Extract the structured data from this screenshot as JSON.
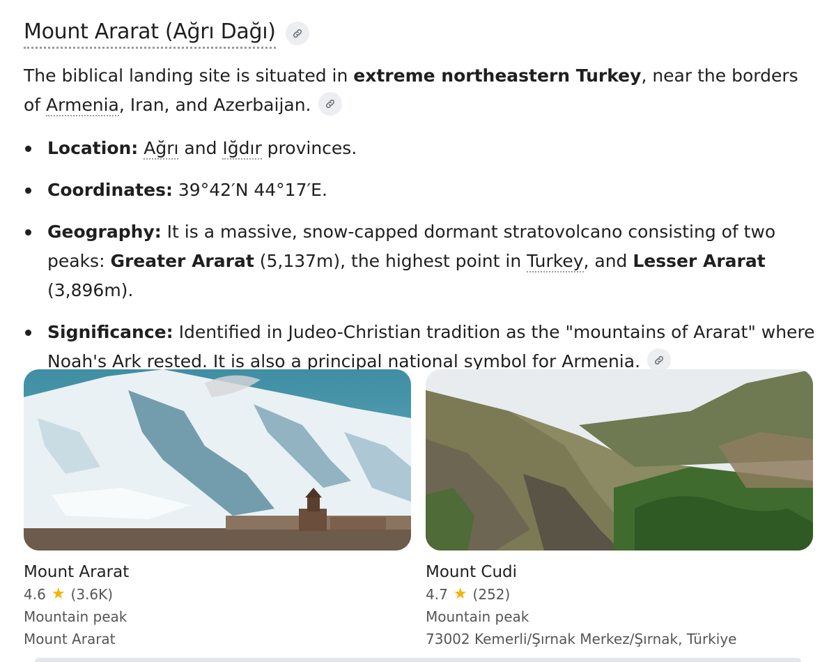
{
  "heading": {
    "title": "Mount Ararat (Ağrı Dağı)",
    "link_icon": "link-icon"
  },
  "intro": {
    "part1": "The biblical landing site is situated in ",
    "bold": "extreme northeastern Turkey",
    "part2": ", near the borders of ",
    "armenia": "Armenia",
    "part3": ", Iran, and Azerbaijan."
  },
  "bullets": {
    "location": {
      "label": "Location:",
      "t1": " ",
      "agri": "Ağrı",
      "t2": " and ",
      "igdir": "Iğdır",
      "t3": " provinces."
    },
    "coordinates": {
      "label": "Coordinates:",
      "text": " 39°42′N 44°17′E."
    },
    "geography": {
      "label": "Geography:",
      "t1": " It is a massive, snow-capped dormant stratovolcano consisting of two peaks: ",
      "b1": "Greater Ararat",
      "t2": " (5,137m), the highest point in ",
      "turkey": "Turkey",
      "t3": ", and ",
      "b2": "Lesser Ararat",
      "t4": " (3,896m)."
    },
    "significance": {
      "label": "Significance:",
      "t1": " Identified in Judeo-Christian tradition as the \"mountains of Ararat\" where Noah's Ark rested. It is also a principal national symbol for ",
      "armenia": "Armenia",
      "t2": "."
    }
  },
  "places": [
    {
      "name": "Mount Ararat",
      "rating": "4.6",
      "reviews": "(3.6K)",
      "category": "Mountain peak",
      "address": "Mount Ararat"
    },
    {
      "name": "Mount Cudi",
      "rating": "4.7",
      "reviews": "(252)",
      "category": "Mountain peak",
      "address": "73002 Kemerli/Şırnak Merkez/Şırnak, Türkiye"
    }
  ],
  "colors": {
    "star": "#f4b400",
    "chip_bg": "#eceef2",
    "text": "#1f1f1f",
    "muted": "#555555"
  }
}
